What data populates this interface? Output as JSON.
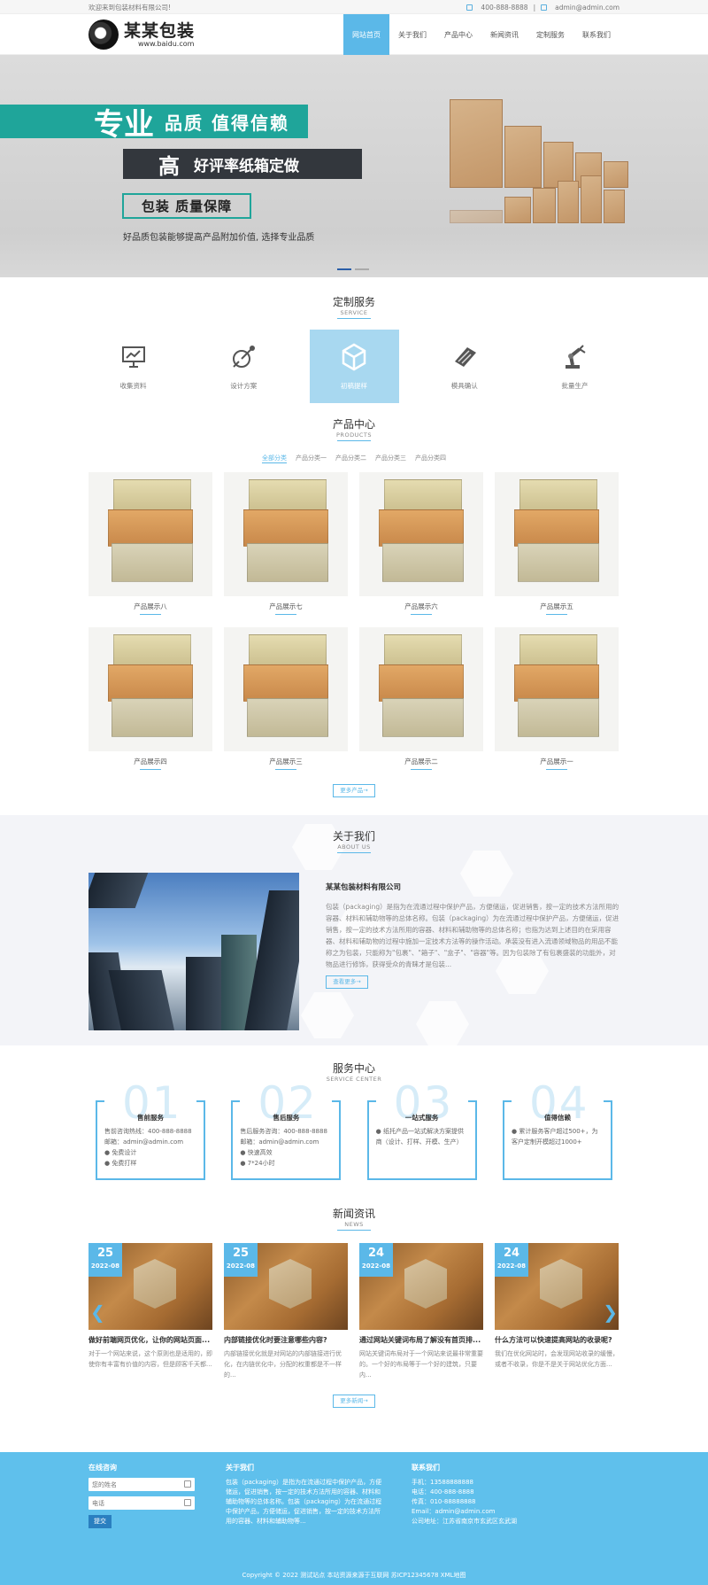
{
  "topbar": {
    "welcome": "欢迎来到包装材料有限公司!",
    "phone": "400-888-8888",
    "sep": "|",
    "email": "admin@admin.com"
  },
  "header": {
    "logo_cn": "某某包装",
    "logo_en": "www.baidu.com"
  },
  "nav": [
    "网站首页",
    "关于我们",
    "产品中心",
    "新闻资讯",
    "定制服务",
    "联系我们"
  ],
  "banner": {
    "line1_big": "专业",
    "line1_small": "品质  值得信赖",
    "line2_big": "高",
    "line2_small": "好评率纸箱定做",
    "line3": "包装  质量保障",
    "line4": "好品质包装能够提高产品附加价值, 选择专业品质"
  },
  "service": {
    "title": "定制服务",
    "subtitle": "SERVICE",
    "items": [
      {
        "label": "收集资料",
        "icon": "presentation-icon"
      },
      {
        "label": "设计方案",
        "icon": "design-icon"
      },
      {
        "label": "初稿提样",
        "icon": "cube-icon"
      },
      {
        "label": "模具确认",
        "icon": "tag-icon"
      },
      {
        "label": "批量生产",
        "icon": "robot-arm-icon"
      }
    ]
  },
  "products": {
    "title": "产品中心",
    "subtitle": "PRODUCTS",
    "tabs": [
      "全部分类",
      "产品分类一",
      "产品分类二",
      "产品分类三",
      "产品分类四"
    ],
    "items": [
      "产品展示八",
      "产品展示七",
      "产品展示六",
      "产品展示五",
      "产品展示四",
      "产品展示三",
      "产品展示二",
      "产品展示一"
    ],
    "more": "更多产品→"
  },
  "about": {
    "title": "关于我们",
    "subtitle": "ABOUT US",
    "company": "某某包装材料有限公司",
    "text": "包装（packaging）是指为在流通过程中保护产品，方便储运，促进销售，按一定的技术方法所用的容器、材料和辅助物等的总体名称。包装（packaging）为在流通过程中保护产品，方便储运，促进销售，按一定的技术方法所用的容器、材料和辅助物等的总体名称；也指为达到上述目的在采用容器、材料和辅助物的过程中施加一定技术方法等的操作活动。承装没有进入流通领域物品的用品不能称之为包装，只能称为\"包裹\"、\"箱子\"、\"盒子\"、\"容器\"等。因为包装除了有包裹盛装的功能外，对物品进行修饰，获得受众的青睐才是包装...",
    "more": "查看更多→"
  },
  "svcenter": {
    "title": "服务中心",
    "subtitle": "SERVICE CENTER",
    "cards": [
      {
        "num": "01",
        "title": "售前服务",
        "lines": [
          "售前咨询热线：400-888-8888",
          "邮箱：admin@admin.com",
          "● 免费设计",
          "● 免费打样"
        ]
      },
      {
        "num": "02",
        "title": "售后服务",
        "lines": [
          "售后服务咨询：400-888-8888",
          "邮箱：admin@admin.com",
          "● 快速高效",
          "● 7*24小时"
        ]
      },
      {
        "num": "03",
        "title": "一站式服务",
        "lines": [
          "● 纸托产品一站式解决方案提供商（设计、打样、开模、生产）"
        ]
      },
      {
        "num": "04",
        "title": "值得信赖",
        "lines": [
          "● 累计服务客户超过500+，为客户定制开模超过1000+"
        ]
      }
    ]
  },
  "news": {
    "title": "新闻资讯",
    "subtitle": "NEWS",
    "items": [
      {
        "day": "25",
        "month": "2022-08",
        "title": "做好前端网页优化，让你的网站页面...",
        "desc": "对于一个网站来说，这个原则也是适用的，即使你有丰富有价值的内容，但是顾客千天都..."
      },
      {
        "day": "25",
        "month": "2022-08",
        "title": "内部链接优化时要注意哪些内容?",
        "desc": "内部链接优化就是对网站的内部链接进行优化，在内链优化中，分配的权重都是不一样的..."
      },
      {
        "day": "24",
        "month": "2022-08",
        "title": "通过网站关键词布局了解没有首页排...",
        "desc": "网站关键词布局对于一个网站来说最非常重要的。一个好的布局等于一个好的建筑，只要内..."
      },
      {
        "day": "24",
        "month": "2022-08",
        "title": "什么方法可以快速提高网站的收录呢?",
        "desc": "我们在优化网站时，会发现网站收录的缓慢，或者不收录，你是不是关于网站优化方面..."
      }
    ],
    "more": "更多新闻→",
    "prev": "❮",
    "next": "❯"
  },
  "footer": {
    "col1_title": "在线咨询",
    "name_placeholder": "您的姓名",
    "phone_placeholder": "电话",
    "submit": "提交",
    "col2_title": "关于我们",
    "col2_text": "包装（packaging）是指为在流通过程中保护产品，方便储运，促进销售，按一定的技术方法所用的容器、材料和辅助物等的总体名称。包装（packaging）为在流通过程中保护产品，方便储运，促进销售，按一定的技术方法所用的容器、材料和辅助物等...",
    "col3_title": "联系我们",
    "col3_lines": [
      "手机：13588888888",
      "电话：400-888-8888",
      "传真：010-88888888",
      "Email：admin@admin.com",
      "公司地址：江苏省南京市玄武区玄武湖"
    ],
    "copyright": "Copyright © 2022 测试站点 本站资源来源于互联网 苏ICP12345678 XML地图"
  },
  "colors": {
    "accent": "#5bb8e8",
    "banner_teal": "#1fa59a",
    "banner_dark": "#33373d",
    "footer_bg": "#5fc0ec"
  }
}
